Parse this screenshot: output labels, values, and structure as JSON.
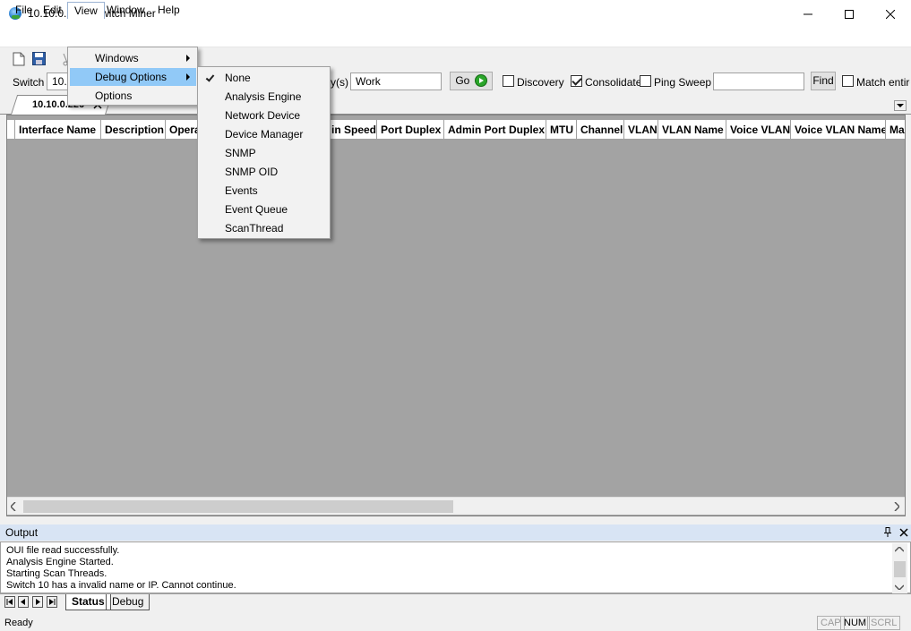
{
  "window": {
    "title": "10.10.0.226 - Switch Miner"
  },
  "menubar": [
    "File",
    "Edit",
    "View",
    "Window",
    "Help"
  ],
  "view_menu": [
    {
      "label": "Windows",
      "submenu": true
    },
    {
      "label": "Debug Options",
      "submenu": true,
      "highlighted": true
    },
    {
      "label": "Options",
      "submenu": false
    }
  ],
  "debug_menu": [
    {
      "label": "None",
      "checked": true
    },
    {
      "label": "Analysis Engine"
    },
    {
      "label": "Network Device"
    },
    {
      "label": "Device Manager"
    },
    {
      "label": "SNMP"
    },
    {
      "label": "SNMP OID"
    },
    {
      "label": "Events"
    },
    {
      "label": "Event Queue"
    },
    {
      "label": "ScanThread"
    }
  ],
  "toolbar": {
    "switch_label": "Switch",
    "switch_value": "10.",
    "community_label_tail": "y(s)",
    "community_value": "Work",
    "go_label": "Go",
    "discovery_label": "Discovery",
    "consolidate_label": "Consolidate",
    "ping_sweep_label": "Ping Sweep",
    "search_value": "",
    "find_label": "Find",
    "match_entire_label": "Match entire"
  },
  "checkboxes": {
    "discovery": false,
    "consolidate": true,
    "ping_sweep": false,
    "match_entire": false
  },
  "doc_tab": {
    "label": "10.10.0.226"
  },
  "grid": {
    "columns": [
      "Interface Name",
      "Description",
      "Opera",
      "in Speed",
      "Port Duplex",
      "Admin Port Duplex",
      "MTU",
      "Channel",
      "VLAN",
      "VLAN Name",
      "Voice VLAN",
      "Voice VLAN Name",
      "Ma"
    ]
  },
  "output": {
    "title": "Output",
    "lines": [
      "OUI file read successfully.",
      "Analysis Engine Started.",
      "Starting Scan Threads.",
      "Switch 10 has a invalid name or IP. Cannot continue."
    ]
  },
  "bottom_tabs": [
    "Status",
    "Debug"
  ],
  "statusbar": {
    "text": "Ready",
    "indicators": [
      "CAP",
      "NUM",
      "SCRL"
    ]
  },
  "colors": {
    "menu_highlight": "#91c9f7",
    "grid_bg": "#a3a3a3",
    "panel_title": "#d8e4f4"
  }
}
